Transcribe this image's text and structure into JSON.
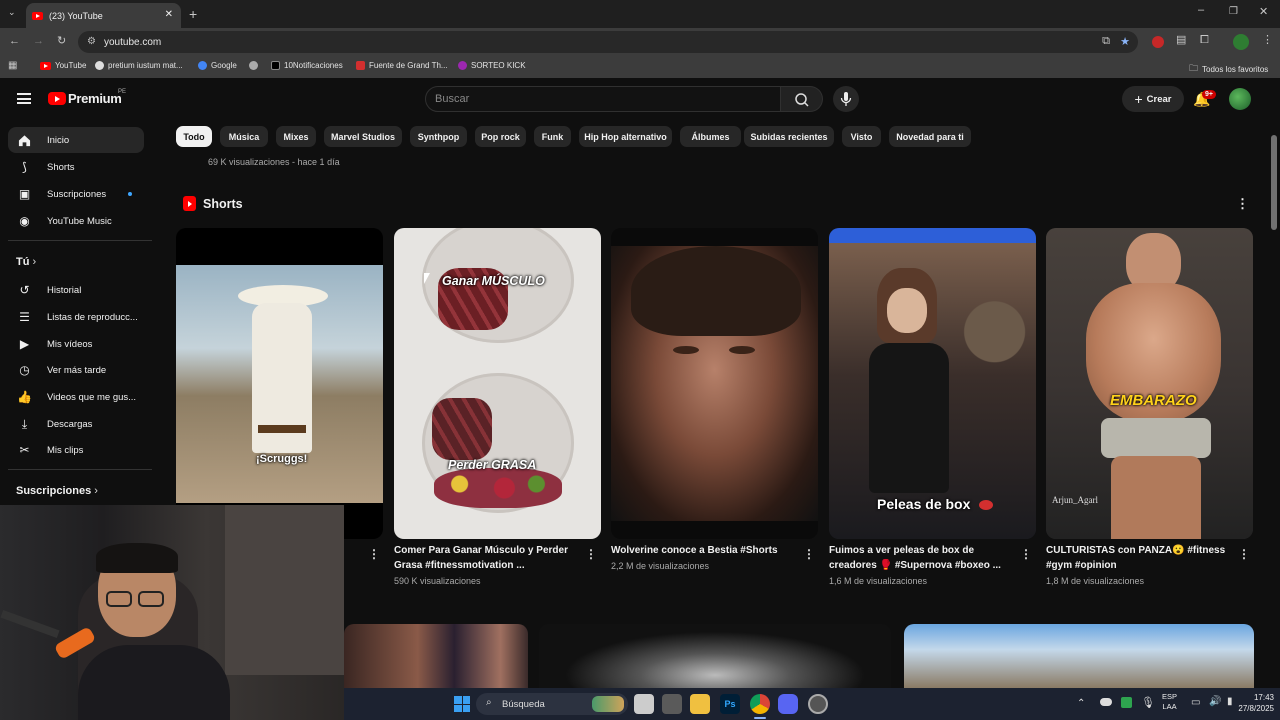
{
  "browser": {
    "tab_title": "(23) YouTube",
    "url": "youtube.com",
    "bookmarks": [
      "YouTube",
      "pretium iustum mat...",
      "Google",
      "10Notificaciones",
      "Fuente de Grand Th...",
      "SORTEO KICK"
    ],
    "all_bookmarks": "Todos los favoritos"
  },
  "youtube": {
    "brand": "Premium",
    "brand_region": "PE",
    "search_placeholder": "Buscar",
    "create_label": "Crear",
    "notif_badge": "9+",
    "sidebar": {
      "main": [
        "Inicio",
        "Shorts",
        "Suscripciones",
        "YouTube Music"
      ],
      "you_header": "Tú",
      "you_items": [
        "Historial",
        "Listas de reproducc...",
        "Mis vídeos",
        "Ver más tarde",
        "Videos que me gus...",
        "Descargas",
        "Mis clips"
      ],
      "subs_header": "Suscripciones"
    },
    "chips": [
      "Todo",
      "Música",
      "Mixes",
      "Marvel Studios",
      "Synthpop",
      "Pop rock",
      "Funk",
      "Hip Hop alternativo",
      "Álbumes",
      "Subidas recientes",
      "Visto",
      "Novedad para ti"
    ],
    "prev_meta": "69 K visualizaciones - hace 1 día",
    "shorts_header": "Shorts",
    "shorts": [
      {
        "title": "",
        "views": "",
        "overlay": "¡Scruggs!"
      },
      {
        "title": "Comer Para Ganar Músculo y Perder Grasa #fitnessmotivation ...",
        "views": "590 K visualizaciones",
        "overlay_top": "Ganar MÚSCULO",
        "overlay_bottom": "Perder GRASA"
      },
      {
        "title": "Wolverine conoce a Bestia #Shorts",
        "views": "2,2 M de visualizaciones"
      },
      {
        "title": "Fuimos a ver peleas de box de creadores 🥊 #Supernova #boxeo ...",
        "views": "1,6 M de visualizaciones",
        "overlay": "Peleas de box",
        "watermark": ""
      },
      {
        "title": "CULTURISTAS con PANZA😮 #fitness #gym #opinion",
        "views": "1,8 M de visualizaciones",
        "overlay": "EMBARAZO",
        "watermark": "Arjun_Agarl"
      }
    ]
  },
  "taskbar": {
    "search": "Búsqueda",
    "lang_top": "ESP",
    "lang_bottom": "LAA",
    "time": "17:43",
    "date": "27/8/2025"
  }
}
